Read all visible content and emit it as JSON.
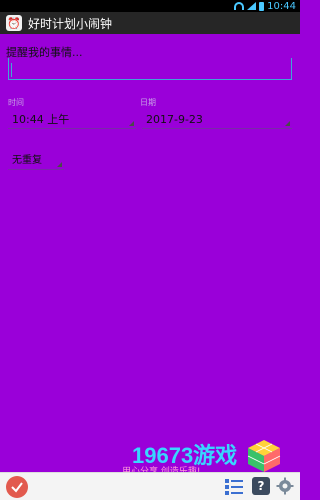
{
  "status_bar": {
    "time": "10:44"
  },
  "app": {
    "title": "好时计划小闹钟"
  },
  "form": {
    "reminder_hint": "提醒我的事情...",
    "time_label": "时间",
    "date_label": "日期",
    "time_value": "10:44 上午",
    "date_value": "2017-9-23",
    "repeat_value": "无重复"
  },
  "watermark": {
    "brand": "19673游戏",
    "slogan": "用心分享  创造乐趣!"
  },
  "colors": {
    "background": "#9a00d9",
    "accent": "#3fa7d6",
    "action_bar": "#262626"
  }
}
